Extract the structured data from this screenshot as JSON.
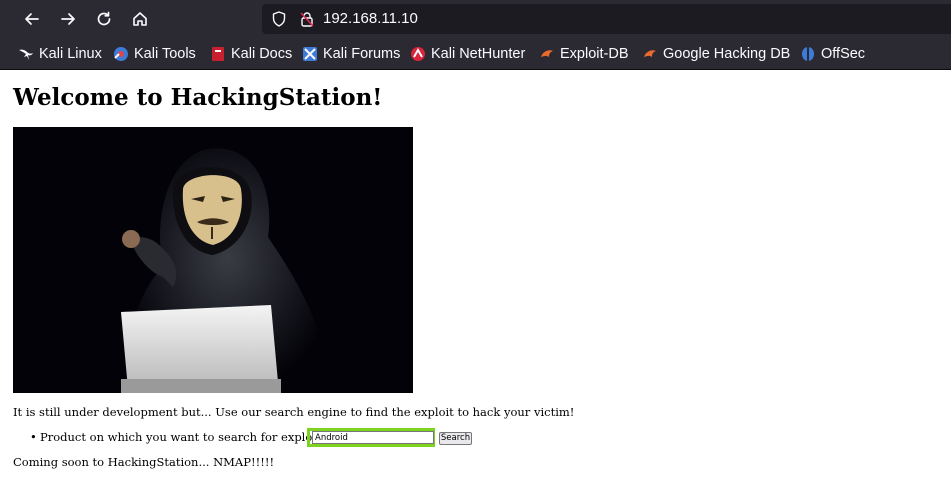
{
  "browser": {
    "url": "192.168.11.10",
    "bookmarks": [
      {
        "label": "Kali Linux",
        "icon": "kali-dragon-icon"
      },
      {
        "label": "Kali Tools",
        "icon": "kali-tools-icon"
      },
      {
        "label": "Kali Docs",
        "icon": "kali-docs-icon"
      },
      {
        "label": "Kali Forums",
        "icon": "kali-forums-icon"
      },
      {
        "label": "Kali NetHunter",
        "icon": "kali-nethunter-icon"
      },
      {
        "label": "Exploit-DB",
        "icon": "exploit-db-icon"
      },
      {
        "label": "Google Hacking DB",
        "icon": "google-hacking-db-icon"
      },
      {
        "label": "OffSec",
        "icon": "offsec-icon"
      }
    ]
  },
  "page": {
    "heading": "Welcome to HackingStation!",
    "intro": "It is still under development but... Use our search engine to find the exploit to hack your victim!",
    "search_label": "Product on which you want to search for exploits",
    "search_value": "Android",
    "search_button": "Search",
    "footer": "Coming soon to HackingStation... NMAP!!!!!"
  },
  "colors": {
    "chrome_bg": "#2b2a33",
    "urlbar_bg": "#1c1b22",
    "focus_highlight": "#7dd320"
  }
}
